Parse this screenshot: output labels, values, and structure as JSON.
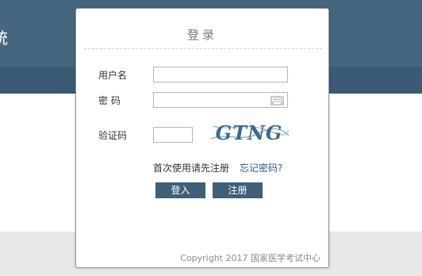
{
  "background": {
    "header_text": "统"
  },
  "dialog": {
    "title": "登录",
    "fields": {
      "username_label": "用户名",
      "username_value": "",
      "password_label": "密 码",
      "password_value": "",
      "captcha_label": "验证码",
      "captcha_value": "",
      "captcha_image_text": "GTNG"
    },
    "first_use_text": "首次使用请先注册",
    "forgot_password_link": "忘记密码?",
    "login_button": "登入",
    "register_button": "注册",
    "copyright": "Copyright 2017 国家医学考试中心"
  },
  "colors": {
    "header": "#46667f",
    "nav": "#3b5a73",
    "button": "#3f5f78",
    "link": "#2a5a8a",
    "captcha_ink": "#3a6a8c"
  },
  "icons": {
    "keyboard": "keyboard-icon"
  }
}
